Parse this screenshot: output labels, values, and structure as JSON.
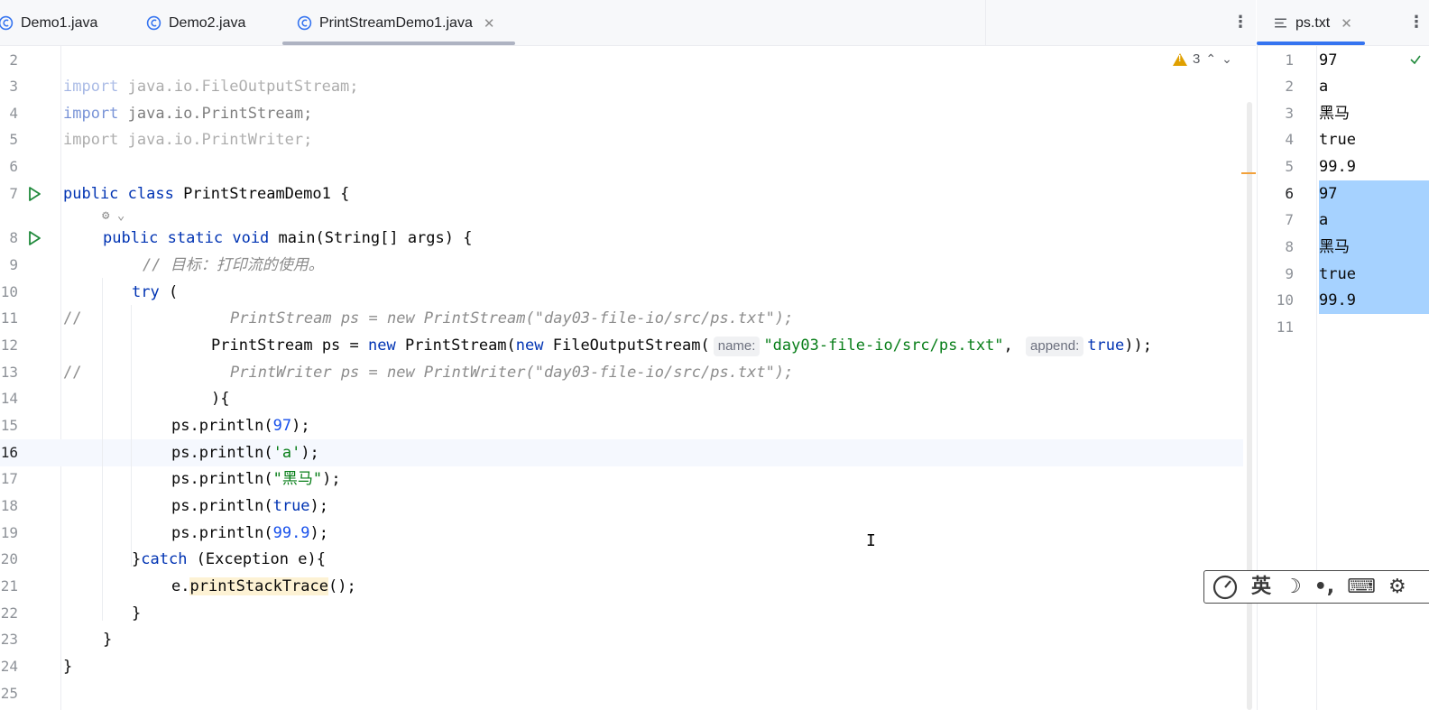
{
  "tabs": [
    {
      "label": "Demo1.java",
      "active": false
    },
    {
      "label": "Demo2.java",
      "active": false
    },
    {
      "label": "PrintStreamDemo1.java",
      "active": true
    }
  ],
  "right_tab": {
    "label": "ps.txt"
  },
  "inspection": {
    "warning_count": "3"
  },
  "editor": {
    "lines": [
      {
        "n": "2"
      },
      {
        "n": "3"
      },
      {
        "n": "4"
      },
      {
        "n": "5"
      },
      {
        "n": "6"
      },
      {
        "n": "7"
      },
      {
        "n": "8"
      },
      {
        "n": "9"
      },
      {
        "n": "10"
      },
      {
        "n": "11"
      },
      {
        "n": "12"
      },
      {
        "n": "13"
      },
      {
        "n": "14"
      },
      {
        "n": "15"
      },
      {
        "n": "16"
      },
      {
        "n": "17"
      },
      {
        "n": "18"
      },
      {
        "n": "19"
      },
      {
        "n": "20"
      },
      {
        "n": "21"
      },
      {
        "n": "22"
      },
      {
        "n": "23"
      },
      {
        "n": "24"
      },
      {
        "n": "25"
      }
    ],
    "code": {
      "l3_kw": "import",
      "l3_rest": " java.io.FileOutputStream;",
      "l4_kw": "import",
      "l4_rest": " java.io.PrintStream;",
      "l5": "import java.io.PrintWriter;",
      "l7_kw1": "public",
      "l7_kw2": "class",
      "l7_rest": " PrintStreamDemo1 {",
      "l8_kw1": "public",
      "l8_kw2": "static",
      "l8_kw3": "void",
      "l8_rest": " main(String[] args) {",
      "l9": "// 目标：打印流的使用。",
      "l10_kw": "try",
      "l10_rest": " (",
      "l11_slashes": "//",
      "l11": "PrintStream ps = new PrintStream(\"day03-file-io/src/ps.txt\");",
      "l12_a": "PrintStream ps = ",
      "l12_new1": "new",
      "l12_b": " PrintStream(",
      "l12_new2": "new",
      "l12_c": " FileOutputStream(",
      "l12_hint1": "name:",
      "l12_str": "\"day03-file-io/src/ps.txt\"",
      "l12_comma": ", ",
      "l12_hint2": "append:",
      "l12_true": "true",
      "l12_end": "));",
      "l13_slashes": "//",
      "l13": "PrintWriter ps = new PrintWriter(\"day03-file-io/src/ps.txt\");",
      "l14": "){",
      "l15_a": "ps.println(",
      "l15_num": "97",
      "l15_b": ");",
      "l16_a": "ps.println(",
      "l16_str": "'a'",
      "l16_b": ");",
      "l17_a": "ps.println(",
      "l17_str": "\"黑马\"",
      "l17_b": ");",
      "l18_a": "ps.println(",
      "l18_kw": "true",
      "l18_b": ");",
      "l19_a": "ps.println(",
      "l19_num": "99.9",
      "l19_b": ");",
      "l20_a": "}",
      "l20_kw": "catch",
      "l20_b": " (Exception e){",
      "l21_a": "e.",
      "l21_m": "printStackTrace",
      "l21_b": "();",
      "l22": "}",
      "l23": "}",
      "l24": "}"
    }
  },
  "ps_txt": {
    "lines": [
      {
        "n": "1",
        "text": "97"
      },
      {
        "n": "2",
        "text": "a"
      },
      {
        "n": "3",
        "text": "黑马"
      },
      {
        "n": "4",
        "text": "true"
      },
      {
        "n": "5",
        "text": "99.9"
      },
      {
        "n": "6",
        "text": "97"
      },
      {
        "n": "7",
        "text": "a"
      },
      {
        "n": "8",
        "text": "黑马"
      },
      {
        "n": "9",
        "text": "true"
      },
      {
        "n": "10",
        "text": "99.9"
      },
      {
        "n": "11",
        "text": ""
      }
    ]
  },
  "ime": {
    "lang": "英",
    "moon": "☽",
    "punct": "•,",
    "keyboard": "⌨",
    "gear": "⚙"
  },
  "colors": {
    "accent": "#3574f0",
    "keyword": "#0033b3",
    "string": "#067d17",
    "number": "#1750eb",
    "selection": "#a6d2ff"
  }
}
